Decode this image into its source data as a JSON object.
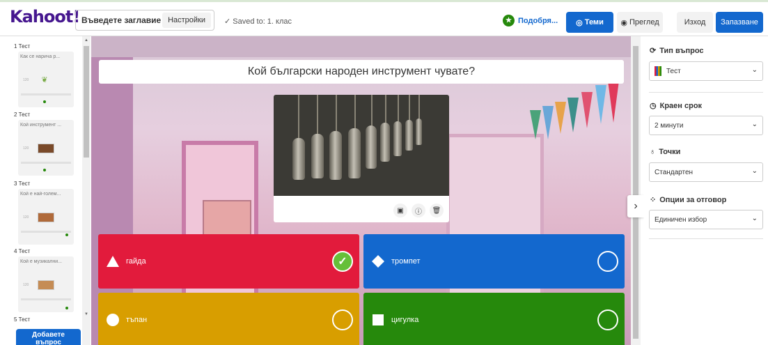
{
  "header": {
    "logo": "Kahoot!",
    "title_placeholder": "Въведете заглавие ...",
    "settings_label": "Настройки",
    "saved_text": "✓  Saved to: 1. клас",
    "suggest_label": "Подобря...",
    "themes_label": "Теми",
    "preview_label": "Преглед",
    "exit_label": "Изход",
    "save_label": "Запазване"
  },
  "sidebar": {
    "slides": [
      {
        "label": "1  Тест",
        "question": "Как се нарича р...",
        "num": "120"
      },
      {
        "label": "2  Тест",
        "question": "Кой инструмент ...",
        "num": "120"
      },
      {
        "label": "3  Тест",
        "question": "Кой е най-голем...",
        "num": "120"
      },
      {
        "label": "4  Тест",
        "question": "Кой е музикални...",
        "num": "120"
      },
      {
        "label": "5  Тест",
        "question": "",
        "num": ""
      }
    ],
    "add_button_line1": "Добавете",
    "add_button_line2": "въпрос"
  },
  "editor": {
    "question": "Кой български народен инструмент чувате?",
    "answers": [
      {
        "text": "гайда",
        "color": "#e21b3c",
        "shape": "triangle",
        "correct": true
      },
      {
        "text": "тромпет",
        "color": "#1368ce",
        "shape": "diamond",
        "correct": false
      },
      {
        "text": "тъпан",
        "color": "#d89e00",
        "shape": "circle",
        "correct": false
      },
      {
        "text": "цигулка",
        "color": "#26890c",
        "shape": "square",
        "correct": false
      }
    ]
  },
  "panel": {
    "question_type_label": "Тип въпрос",
    "question_type_value": "Тест",
    "time_limit_label": "Краен срок",
    "time_limit_value": "2 минути",
    "points_label": "Точки",
    "points_value": "Стандартен",
    "answer_options_label": "Опции за отговор",
    "answer_options_value": "Единичен избор"
  }
}
